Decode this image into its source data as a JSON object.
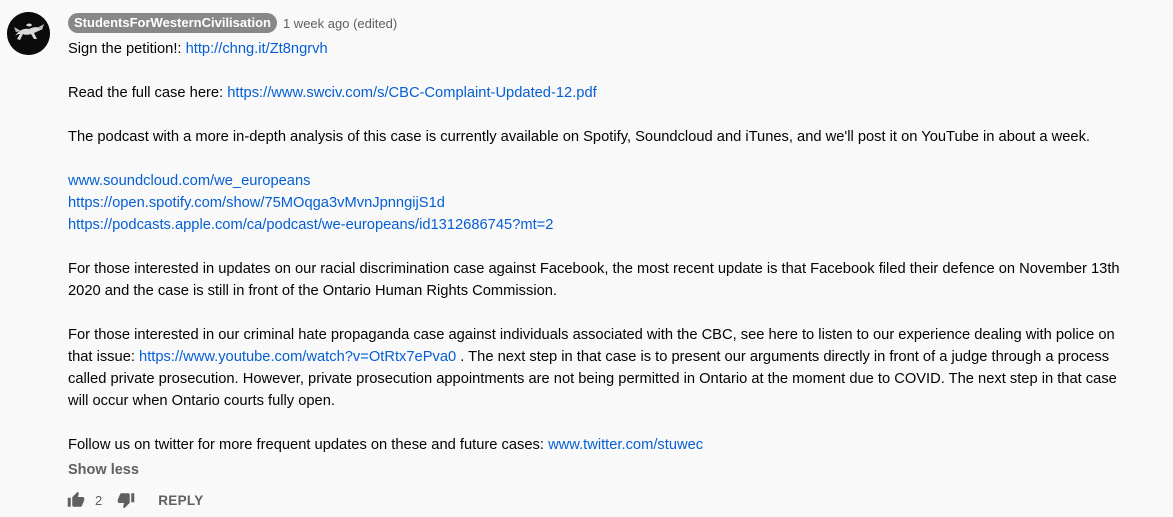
{
  "comment": {
    "author": "StudentsForWesternCivilisation",
    "timestamp": "1 week ago (edited)",
    "petition_prefix": "Sign the petition!: ",
    "petition_link": "http://chng.it/Zt8ngrvh",
    "case_prefix": "Read the full case here: ",
    "case_link": "https://www.swciv.com/s/CBC-Complaint-Updated-12.pdf",
    "podcast_text": "The podcast with a more in-depth analysis of this case is currently available on Spotify, Soundcloud and iTunes, and we'll post it on YouTube in about a week.",
    "podcast_links": [
      "www.soundcloud.com/we_europeans",
      "https://open.spotify.com/show/75MOqga3vMvnJpnngijS1d",
      "https://podcasts.apple.com/ca/podcast/we-europeans/id1312686745?mt=2"
    ],
    "facebook_line1": "For those interested in updates on our racial discrimination case against Facebook, the most recent update is that Facebook filed their defence on November 13th",
    "facebook_line2": "2020 and the case is still in front of the Ontario Human Rights Commission.",
    "cbc_line1": "For those interested in our criminal hate propaganda case against individuals associated with the CBC, see here to listen to our experience dealing with police on",
    "cbc_line2_prefix": "that issue: ",
    "cbc_line2_link": "https://www.youtube.com/watch?v=OtRtx7ePva0",
    "cbc_line2_suffix": " . The next step in that case is to present our arguments directly in front of a judge through a process",
    "cbc_line3": "called private prosecution. However, private prosecution appointments are not being permitted in Ontario at the moment due to COVID. The next step in that case",
    "cbc_line4": "will occur when Ontario courts fully open.",
    "twitter_prefix": "Follow us on twitter for more frequent updates on these and future cases: ",
    "twitter_link": "www.twitter.com/stuwec",
    "show_less_label": "Show less"
  },
  "actions": {
    "like_icon": "thumbs-up-icon",
    "like_count": "2",
    "dislike_icon": "thumbs-down-icon",
    "reply_label": "REPLY"
  },
  "colors": {
    "link": "#065fd4",
    "secondary_text": "#606060",
    "author_badge_bg": "#888888",
    "background": "#f9f9f9"
  }
}
